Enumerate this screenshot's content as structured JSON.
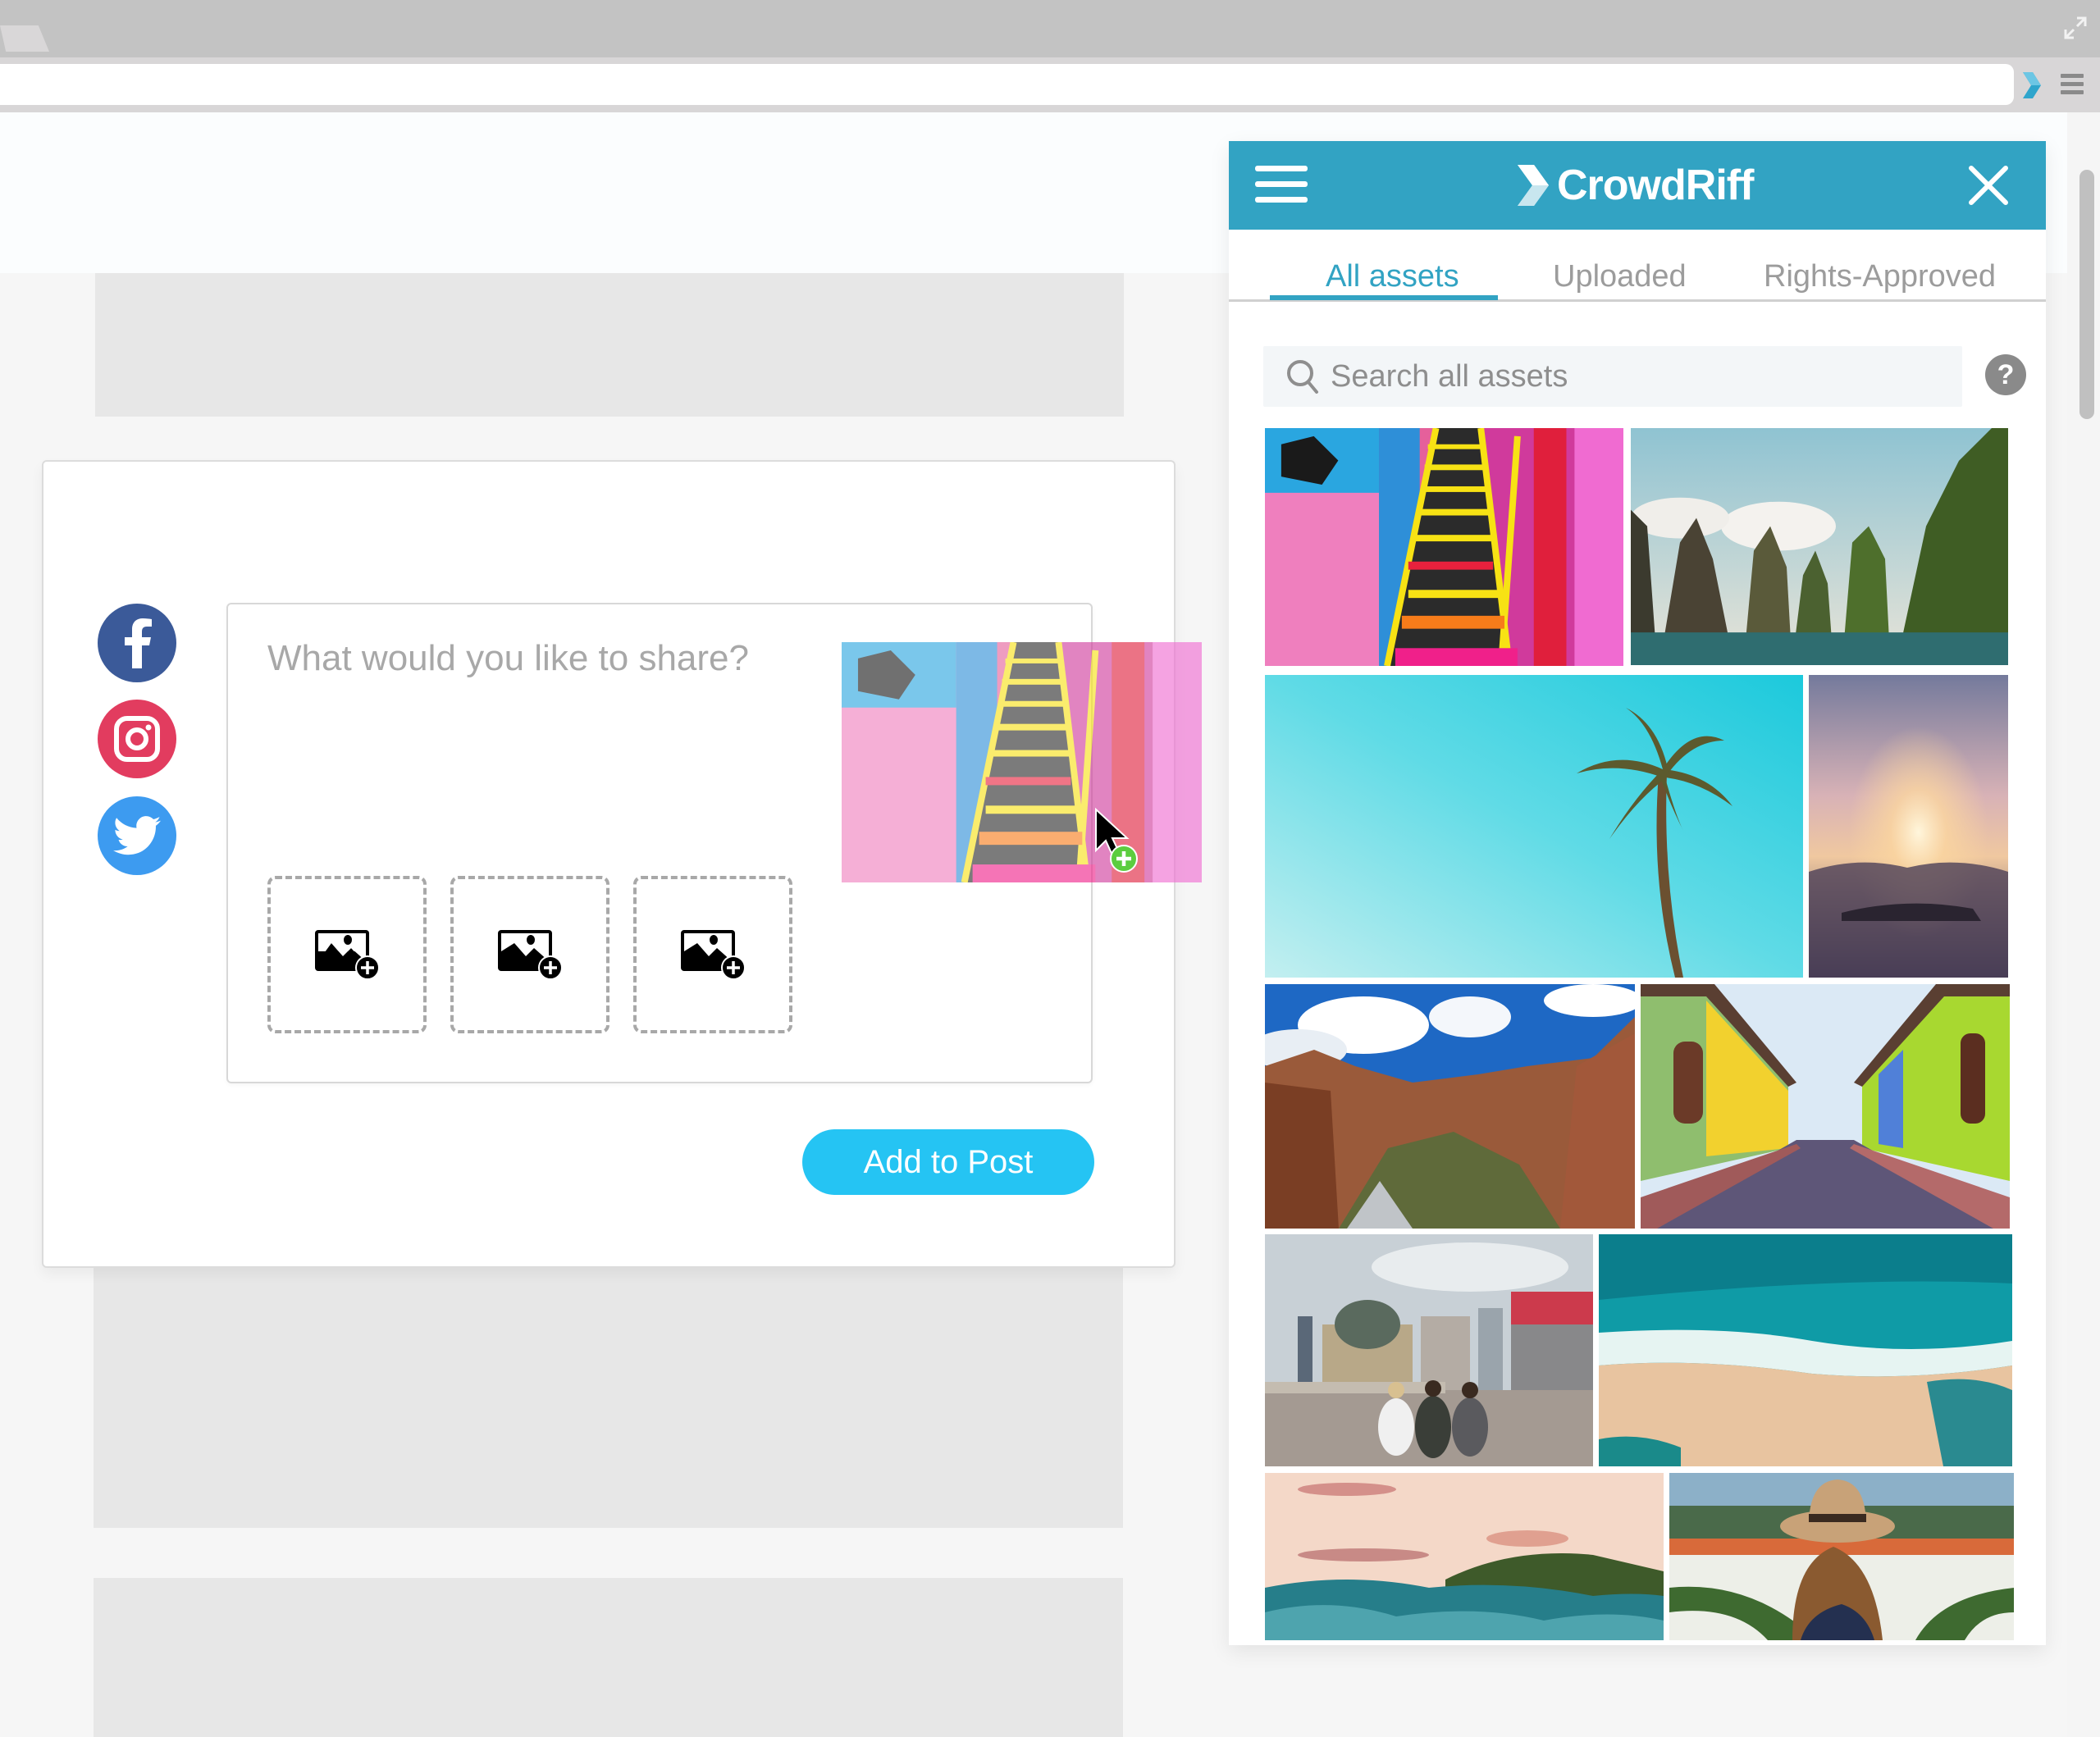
{
  "browser": {
    "expand_icon": "expand-arrows-icon",
    "extension_icon": "crowdriff-chevron-icon",
    "menu_icon": "hamburger-menu-icon"
  },
  "composer": {
    "placeholder": "What would you like to share?",
    "value": "",
    "social_networks": [
      {
        "name": "Facebook",
        "icon": "facebook-icon",
        "color": "#3b5a99"
      },
      {
        "name": "Instagram",
        "icon": "instagram-icon",
        "color": "#e23c5f"
      },
      {
        "name": "Twitter",
        "icon": "twitter-icon",
        "color": "#3d9bf0"
      }
    ],
    "image_slots": [
      {
        "icon": "add-image-icon"
      },
      {
        "icon": "add-image-icon"
      },
      {
        "icon": "add-image-icon"
      }
    ],
    "add_button_label": "Add to Post",
    "add_button_color": "#25c4f3"
  },
  "drag": {
    "image": "graffiti-staircase",
    "cursor_badge_icon": "plus-circle-icon",
    "badge_color": "#5ccd3f"
  },
  "panel": {
    "brand": "CrowdRiff",
    "header_color": "#32a3c3",
    "tabs": [
      {
        "label": "All assets",
        "active": true
      },
      {
        "label": "Uploaded",
        "active": false
      },
      {
        "label": "Rights-Approved",
        "active": false
      }
    ],
    "search": {
      "placeholder": "Search all assets",
      "value": ""
    },
    "help_label": "?",
    "assets": [
      {
        "subject": "graffiti-staircase"
      },
      {
        "subject": "karst-islands-lake"
      },
      {
        "subject": "palm-tree-sky"
      },
      {
        "subject": "sunrise-above-clouds"
      },
      {
        "subject": "canyon-landscape"
      },
      {
        "subject": "colorful-street"
      },
      {
        "subject": "city-square-people"
      },
      {
        "subject": "aerial-beach-waves"
      },
      {
        "subject": "sunset-ocean-waves"
      },
      {
        "subject": "woman-hat-tulips"
      }
    ]
  }
}
